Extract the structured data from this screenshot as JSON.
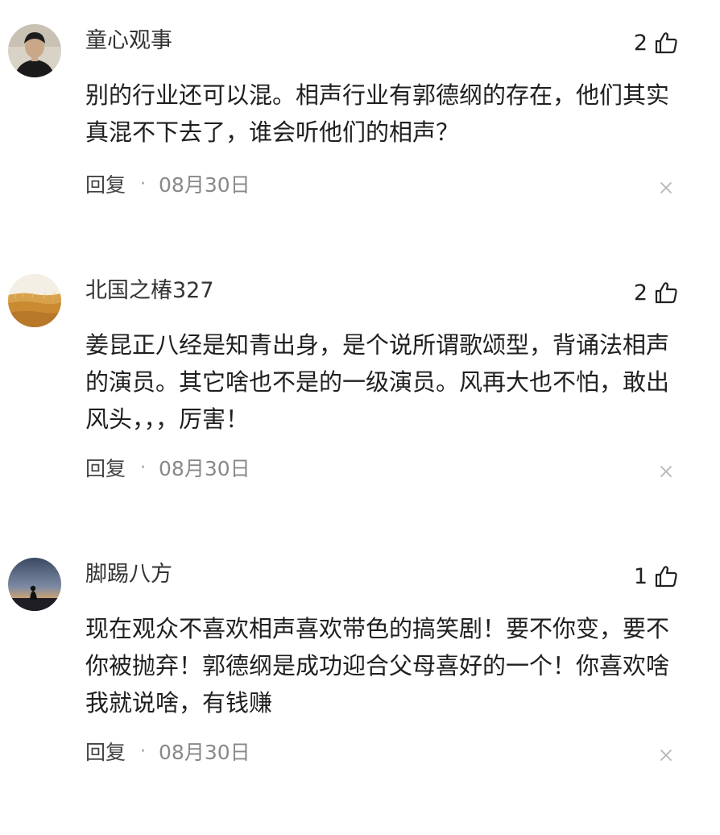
{
  "comments": [
    {
      "username": "童心观事",
      "likes": "2",
      "text": "别的行业还可以混。相声行业有郭德纲的存在，他们其实真混不下去了，谁会听他们的相声？",
      "reply_label": "回复",
      "separator": "·",
      "date": "08月30日",
      "avatar_icon": "portrait-avatar",
      "like_icon": "thumbs-up-icon",
      "close_icon": "close-icon"
    },
    {
      "username": "北国之椿327",
      "likes": "2",
      "text": "姜昆正八经是知青出身，是个说所谓歌颂型，背诵法相声的演员。其它啥也不是的一级演员。风再大也不怕，敢出风头，，，厉害！",
      "reply_label": "回复",
      "separator": "·",
      "date": "08月30日",
      "avatar_icon": "wheat-field-avatar",
      "like_icon": "thumbs-up-icon",
      "close_icon": "close-icon"
    },
    {
      "username": "脚踢八方",
      "likes": "1",
      "text": "现在观众不喜欢相声喜欢带色的搞笑剧！要不你变，要不你被抛弃！郭德纲是成功迎合父母喜好的一个！你喜欢啥我就说啥，有钱赚",
      "reply_label": "回复",
      "separator": "·",
      "date": "08月30日",
      "avatar_icon": "silhouette-sunset-avatar",
      "like_icon": "thumbs-up-icon",
      "close_icon": "close-icon"
    }
  ],
  "colors": {
    "text": "#1f1f1f",
    "username": "#333333",
    "meta": "#888888",
    "background": "#ffffff"
  }
}
